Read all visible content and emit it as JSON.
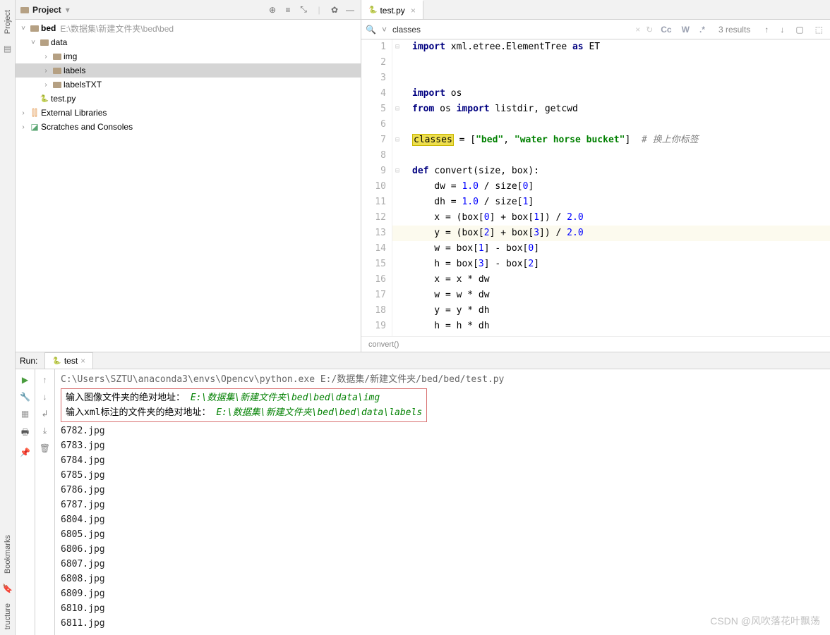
{
  "sidebar": {
    "project_label": "Project",
    "bookmarks_label": "Bookmarks",
    "structure_label": "tructure"
  },
  "project": {
    "title": "Project",
    "root": {
      "name": "bed",
      "path": "E:\\数据集\\新建文件夹\\bed\\bed"
    },
    "items": [
      {
        "name": "data",
        "level": 1,
        "expanded": true,
        "type": "folder"
      },
      {
        "name": "img",
        "level": 2,
        "expanded": false,
        "type": "folder"
      },
      {
        "name": "labels",
        "level": 2,
        "expanded": false,
        "type": "folder",
        "selected": true
      },
      {
        "name": "labelsTXT",
        "level": 2,
        "expanded": false,
        "type": "folder"
      },
      {
        "name": "test.py",
        "level": 1,
        "type": "python"
      }
    ],
    "external": "External Libraries",
    "scratches": "Scratches and Consoles"
  },
  "editor": {
    "tab": "test.py",
    "search": {
      "query": "classes",
      "results": "3 results",
      "cc": "Cc",
      "w": "W"
    },
    "breadcrumb": "convert()",
    "lines": [
      {
        "n": 1,
        "tokens": [
          [
            "kw",
            "import"
          ],
          [
            "",
            " xml.etree.ElementTree "
          ],
          [
            "kw",
            "as"
          ],
          [
            "",
            " ET"
          ]
        ]
      },
      {
        "n": 2,
        "tokens": []
      },
      {
        "n": 3,
        "tokens": []
      },
      {
        "n": 4,
        "tokens": [
          [
            "kw",
            "import"
          ],
          [
            "",
            " os"
          ]
        ]
      },
      {
        "n": 5,
        "tokens": [
          [
            "kw",
            "from"
          ],
          [
            "",
            " os "
          ],
          [
            "kw",
            "import"
          ],
          [
            "",
            " listdir, getcwd"
          ]
        ]
      },
      {
        "n": 6,
        "tokens": []
      },
      {
        "n": 7,
        "tokens": [
          [
            "hl",
            "classes"
          ],
          [
            "",
            " = ["
          ],
          [
            "str",
            "\"bed\""
          ],
          [
            "",
            ", "
          ],
          [
            "str",
            "\"water horse bucket\""
          ],
          [
            "",
            "]  "
          ],
          [
            "comment",
            "# 换上你标签"
          ]
        ]
      },
      {
        "n": 8,
        "tokens": []
      },
      {
        "n": 9,
        "tokens": [
          [
            "kw",
            "def"
          ],
          [
            "",
            " "
          ],
          [
            "fn",
            "convert"
          ],
          [
            "",
            "(size, box):"
          ]
        ]
      },
      {
        "n": 10,
        "tokens": [
          [
            "",
            "    dw = "
          ],
          [
            "num",
            "1.0"
          ],
          [
            "",
            " / size["
          ],
          [
            "num",
            "0"
          ],
          [
            "",
            "]"
          ]
        ]
      },
      {
        "n": 11,
        "tokens": [
          [
            "",
            "    dh = "
          ],
          [
            "num",
            "1.0"
          ],
          [
            "",
            " / size["
          ],
          [
            "num",
            "1"
          ],
          [
            "",
            "]"
          ]
        ]
      },
      {
        "n": 12,
        "tokens": [
          [
            "",
            "    x = (box["
          ],
          [
            "num",
            "0"
          ],
          [
            "",
            "] + box["
          ],
          [
            "num",
            "1"
          ],
          [
            "",
            "]) / "
          ],
          [
            "num",
            "2.0"
          ]
        ]
      },
      {
        "n": 13,
        "caret": true,
        "tokens": [
          [
            "",
            "    y = (box["
          ],
          [
            "num",
            "2"
          ],
          [
            "",
            "] + box["
          ],
          [
            "num",
            "3"
          ],
          [
            "",
            "]) / "
          ],
          [
            "num",
            "2.0"
          ]
        ]
      },
      {
        "n": 14,
        "tokens": [
          [
            "",
            "    w = box["
          ],
          [
            "num",
            "1"
          ],
          [
            "",
            "] - box["
          ],
          [
            "num",
            "0"
          ],
          [
            "",
            "]"
          ]
        ]
      },
      {
        "n": 15,
        "tokens": [
          [
            "",
            "    h = box["
          ],
          [
            "num",
            "3"
          ],
          [
            "",
            "] - box["
          ],
          [
            "num",
            "2"
          ],
          [
            "",
            "]"
          ]
        ]
      },
      {
        "n": 16,
        "tokens": [
          [
            "",
            "    x = x * dw"
          ]
        ]
      },
      {
        "n": 17,
        "tokens": [
          [
            "",
            "    w = w * dw"
          ]
        ]
      },
      {
        "n": 18,
        "tokens": [
          [
            "",
            "    y = y * dh"
          ]
        ]
      },
      {
        "n": 19,
        "tokens": [
          [
            "",
            "    h = h * dh"
          ]
        ]
      }
    ]
  },
  "run": {
    "label": "Run:",
    "tab": "test",
    "cmd": "C:\\Users\\SZTU\\anaconda3\\envs\\Opencv\\python.exe E:/数据集/新建文件夹/bed/bed/test.py",
    "prompt1_label": "输入图像文件夹的绝对地址：",
    "prompt1_value": "E:\\数据集\\新建文件夹\\bed\\bed\\data\\img",
    "prompt2_label": "输入xml标注的文件夹的绝对地址：",
    "prompt2_value": "E:\\数据集\\新建文件夹\\bed\\bed\\data\\labels",
    "files": [
      "6782.jpg",
      "6783.jpg",
      "6784.jpg",
      "6785.jpg",
      "6786.jpg",
      "6787.jpg",
      "6804.jpg",
      "6805.jpg",
      "6806.jpg",
      "6807.jpg",
      "6808.jpg",
      "6809.jpg",
      "6810.jpg",
      "6811.jpg"
    ]
  },
  "watermark": "CSDN @风吹落花叶飘荡"
}
